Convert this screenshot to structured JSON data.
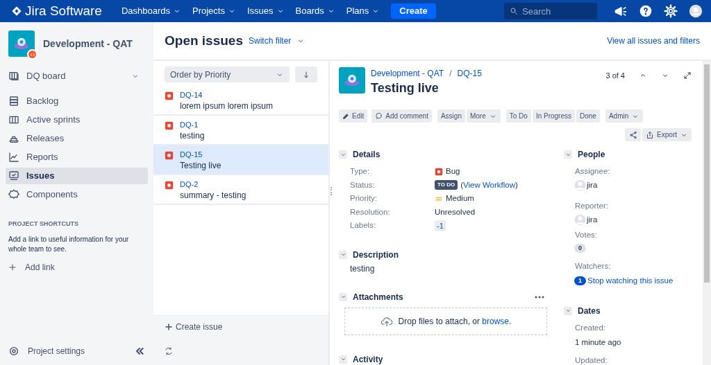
{
  "topbar": {
    "product": "Jira Software",
    "menus": [
      "Dashboards",
      "Projects",
      "Issues",
      "Boards",
      "Plans"
    ],
    "create": "Create",
    "search": {
      "placeholder": "Search"
    }
  },
  "sidebar": {
    "project": "Development - QAT",
    "items": [
      {
        "label": "DQ board",
        "selected": false,
        "expandable": true
      },
      {
        "label": "Backlog",
        "selected": false,
        "expandable": false
      },
      {
        "label": "Active sprints",
        "selected": false,
        "expandable": false
      },
      {
        "label": "Releases",
        "selected": false,
        "expandable": false
      },
      {
        "label": "Reports",
        "selected": false,
        "expandable": false
      },
      {
        "label": "Issues",
        "selected": true,
        "expandable": false
      },
      {
        "label": "Components",
        "selected": false,
        "expandable": false
      }
    ],
    "shortcuts_heading": "PROJECT SHORTCUTS",
    "shortcuts_text": "Add a link to useful information for your whole team to see.",
    "add_link": "Add link",
    "settings": "Project settings"
  },
  "header": {
    "title": "Open issues",
    "switch_filter": "Switch filter",
    "view_all": "View all issues and filters"
  },
  "issue_list": {
    "order": "Order by Priority",
    "issues": [
      {
        "key": "DQ-14",
        "summary": "lorem ipsum lorem ipsum",
        "selected": false
      },
      {
        "key": "DQ-1",
        "summary": "testing",
        "selected": false
      },
      {
        "key": "DQ-15",
        "summary": "Testing live",
        "selected": true
      },
      {
        "key": "DQ-2",
        "summary": "summary - testing",
        "selected": false
      }
    ],
    "create_issue": "Create issue"
  },
  "issue": {
    "project": "Development - QAT",
    "separator": "/",
    "key": "DQ-15",
    "title": "Testing live",
    "position": "3 of 4",
    "actions": [
      "Edit",
      "Add comment",
      "Assign",
      "More",
      "To Do",
      "In Progress",
      "Done",
      "Admin"
    ],
    "export": "Export",
    "details_heading": "Details",
    "details": [
      {
        "label": "Type:",
        "kind": "type",
        "value": "Bug"
      },
      {
        "label": "Status:",
        "kind": "status",
        "value": "TO DO",
        "link_prefix": "(",
        "link": "View Workflow",
        "link_suffix": ")"
      },
      {
        "label": "Priority:",
        "kind": "priority",
        "value": "Medium"
      },
      {
        "label": "Resolution:",
        "kind": "text",
        "value": "Unresolved"
      },
      {
        "label": "Labels:",
        "kind": "label",
        "value": "-1"
      }
    ],
    "description_heading": "Description",
    "description": "testing",
    "attachments_heading": "Attachments",
    "drop_text": "Drop files to attach, or",
    "browse": "browse.",
    "activity_heading": "Activity",
    "people_heading": "People",
    "assignee_label": "Assignee:",
    "assignee": "jira",
    "reporter_label": "Reporter:",
    "reporter": "jira",
    "votes_label": "Votes:",
    "votes": "0",
    "watchers_label": "Watchers:",
    "watchers": "1",
    "watch_link": "Stop watching this issue",
    "dates_heading": "Dates",
    "created_label": "Created:",
    "created": "1 minute ago",
    "updated_label": "Updated:"
  }
}
